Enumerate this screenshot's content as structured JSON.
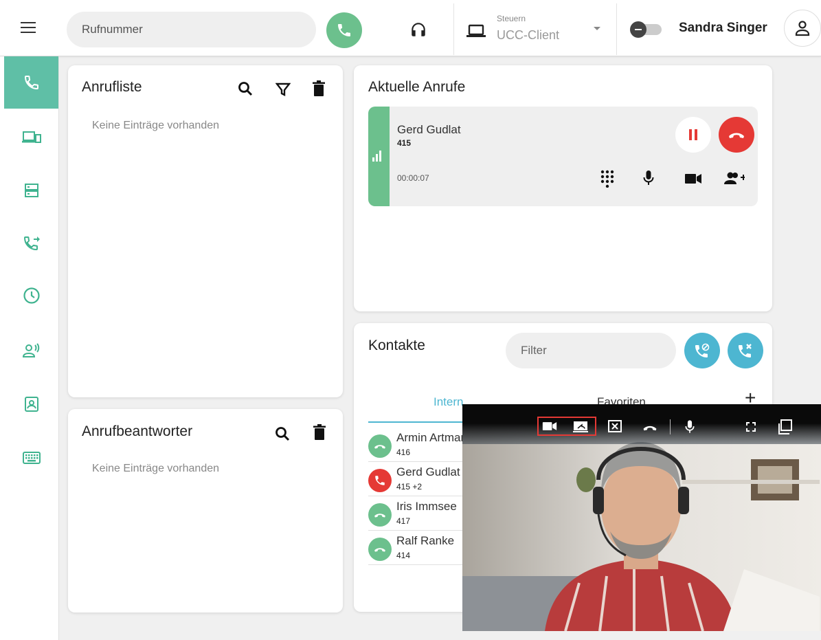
{
  "header": {
    "search_placeholder": "Rufnummer",
    "control_label": "Steuern",
    "control_value": "UCC-Client",
    "user_name": "Sandra Singer"
  },
  "sidebar": {
    "items": [
      {
        "icon": "phone-icon",
        "active": true
      },
      {
        "icon": "devices-icon",
        "active": false
      },
      {
        "icon": "server-icon",
        "active": false
      },
      {
        "icon": "call-forward-icon",
        "active": false
      },
      {
        "icon": "clock-icon",
        "active": false
      },
      {
        "icon": "presence-icon",
        "active": false
      },
      {
        "icon": "contact-card-icon",
        "active": false
      },
      {
        "icon": "keyboard-icon",
        "active": false
      }
    ]
  },
  "call_list": {
    "title": "Anrufliste",
    "empty_text": "Keine Einträge vorhanden"
  },
  "voicemail": {
    "title": "Anrufbeantworter",
    "empty_text": "Keine Einträge vorhanden"
  },
  "current_calls": {
    "title": "Aktuelle Anrufe",
    "call": {
      "name": "Gerd Gudlat",
      "number": "415",
      "duration": "00:00:07"
    }
  },
  "contacts": {
    "title": "Kontakte",
    "filter_placeholder": "Filter",
    "tabs": [
      "Intern",
      "Favoriten"
    ],
    "add_label": "+",
    "items": [
      {
        "name": "Armin Artmann",
        "number": "416",
        "status": "available"
      },
      {
        "name": "Gerd Gudlat",
        "number": "415 +2",
        "status": "busy"
      },
      {
        "name": "Iris Immsee",
        "number": "417",
        "status": "available"
      },
      {
        "name": "Ralf Ranke",
        "number": "414",
        "status": "available"
      }
    ]
  },
  "colors": {
    "accent_green": "#6cc08d",
    "accent_teal": "#5fbfa6",
    "accent_blue": "#4db6d1",
    "danger_red": "#e53935"
  }
}
